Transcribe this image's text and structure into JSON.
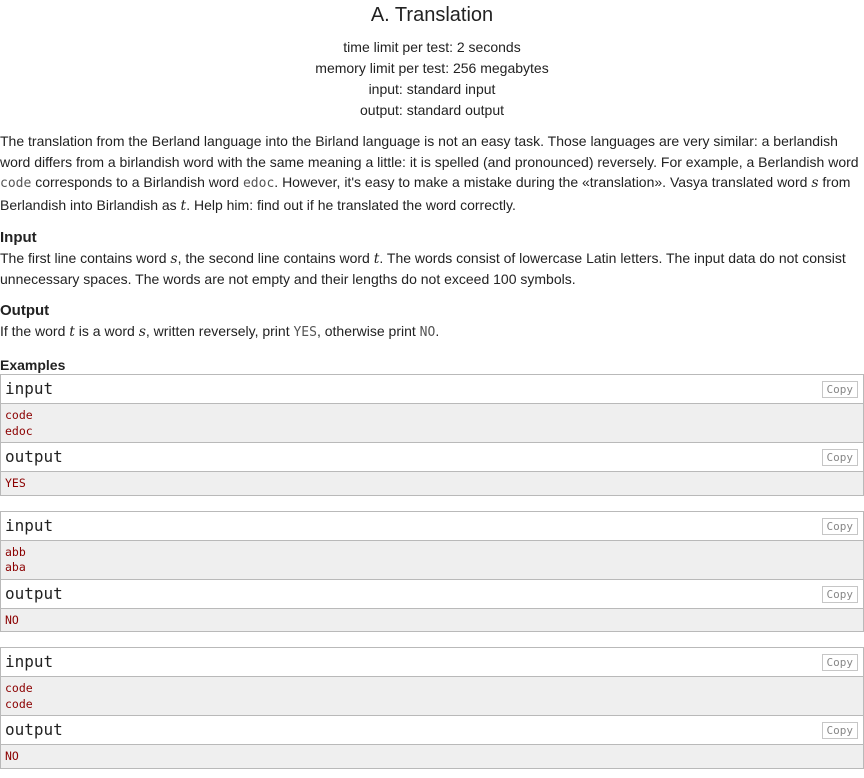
{
  "problem": {
    "title": "A. Translation",
    "limits": [
      "time limit per test: 2 seconds",
      "memory limit per test: 256 megabytes",
      "input: standard input",
      "output: standard output"
    ]
  },
  "legend": {
    "p1": "The translation from the Berland language into the Birland language is not an easy task. Those languages are very similar: a berlandish word differs from a birlandish word with the same meaning a little: it is spelled (and pronounced) reversely. For example, a Berlandish word ",
    "code1": "code",
    "p2": " corresponds to a Birlandish word ",
    "code2": "edoc",
    "p3": ". However, it's easy to make a mistake during the «translation». Vasya translated word ",
    "var_s": "s",
    "p4": " from Berlandish into Birlandish as ",
    "var_t": "t",
    "p5": ". Help him: find out if he translated the word correctly."
  },
  "input_section": {
    "title": "Input",
    "p1": "The first line contains word ",
    "var_s": "s",
    "p2": ", the second line contains word ",
    "var_t": "t",
    "p3": ". The words consist of lowercase Latin letters. The input data do not consist unnecessary spaces. The words are not empty and their lengths do not exceed 100 symbols."
  },
  "output_section": {
    "title": "Output",
    "p1": "If the word ",
    "var_t": "t",
    "p2": " is a word ",
    "var_s": "s",
    "p3": ", written reversely, print ",
    "yes": "YES",
    "p4": ", otherwise print ",
    "no": "NO",
    "p5": "."
  },
  "examples": {
    "title": "Examples",
    "input_label": "input",
    "output_label": "output",
    "copy_label": "Copy",
    "items": [
      {
        "input": [
          "code",
          "edoc"
        ],
        "output": [
          "YES"
        ]
      },
      {
        "input": [
          "abb",
          "aba"
        ],
        "output": [
          "NO"
        ]
      },
      {
        "input": [
          "code",
          "code"
        ],
        "output": [
          "NO"
        ]
      }
    ]
  }
}
